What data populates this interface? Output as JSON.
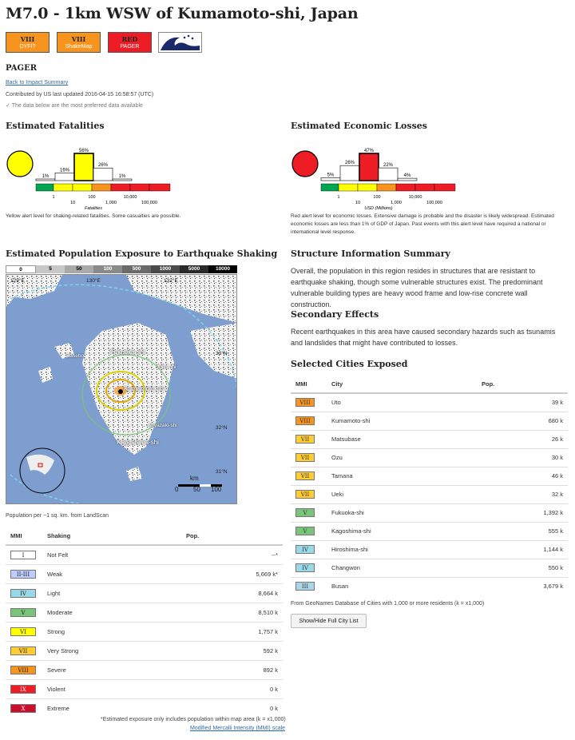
{
  "title": "M7.0 - 1km WSW of Kumamoto-shi, Japan",
  "badges": [
    {
      "level": "VIII",
      "sub": "DYFI?",
      "color": "#f7941d"
    },
    {
      "level": "VIII",
      "sub": "ShakeMap",
      "color": "#f7941d"
    },
    {
      "level": "RED",
      "sub": "PAGER",
      "color": "#ee1c25"
    }
  ],
  "tsunami_icon": "tsunami-icon",
  "section_label": "PAGER",
  "back_link": "Back to Impact Summary",
  "contributed": "Contributed by US last updated 2016-04-15 16:58:57 (UTC)",
  "preferred_note": "The data below are the most preferred data available",
  "fatalities": {
    "heading": "Estimated Fatalities",
    "alert_color": "#ffff00",
    "bars": [
      {
        "pct": "1%",
        "v": 1
      },
      {
        "pct": "16%",
        "v": 16
      },
      {
        "pct": "56%",
        "v": 56
      },
      {
        "pct": "26%",
        "v": 26
      },
      {
        "pct": "1%",
        "v": 1
      }
    ],
    "ticks": [
      "1",
      "10",
      "100",
      "1,000",
      "10,000",
      "100,000"
    ],
    "axis_label": "Fatalities",
    "caption": "Yellow alert level for shaking-related fatalities. Some casualties are possible."
  },
  "losses": {
    "heading": "Estimated Economic Losses",
    "alert_color": "#ee1c25",
    "bars": [
      {
        "pct": "5%",
        "v": 5
      },
      {
        "pct": "26%",
        "v": 26
      },
      {
        "pct": "47%",
        "v": 47
      },
      {
        "pct": "22%",
        "v": 22
      },
      {
        "pct": "4%",
        "v": 4
      }
    ],
    "ticks": [
      "1",
      "10",
      "100",
      "1,000",
      "10,000",
      "100,000"
    ],
    "axis_label": "USD (Millions)",
    "caption": "Red alert level for economic losses. Extensive damage is probable and the disaster is likely widespread. Estimated economic losses are less than 1% of GDP of Japan. Past events with this alert level have required a national or international level response."
  },
  "exposure": {
    "heading": "Estimated Population Exposure to Earthquake Shaking",
    "legend": [
      "0",
      "5",
      "50",
      "100",
      "500",
      "1000",
      "5000",
      "10000"
    ],
    "map_labels": {
      "lon1": "129°E",
      "lon2": "130°E",
      "lon3": "132°E",
      "lat1": "33°N",
      "lat2": "32°N",
      "lat3": "31°N",
      "city1": "Fukuoka-shi",
      "city2": "Kumamoto-shi",
      "city3": "Kagoshima-shi",
      "city4": "Miyazaki-shi",
      "city5": "Oita-shi",
      "city6": "Sasebo",
      "scale_title": "km",
      "scale0": "0",
      "scale50": "50",
      "scale100": "100"
    },
    "pop_note": "Population per ~1 sq. km. from LandScan",
    "table_headers": [
      "MMI",
      "Shaking",
      "Pop."
    ],
    "rows": [
      {
        "mmi": "I",
        "label": "Not Felt",
        "pop": "--*",
        "color": "#ffffff",
        "tc": "#222"
      },
      {
        "mmi": "II-III",
        "label": "Weak",
        "pop": "5,669 k*",
        "color": "#bfccff",
        "tc": "#222"
      },
      {
        "mmi": "IV",
        "label": "Light",
        "pop": "8,664 k",
        "color": "#99d8e6",
        "tc": "#222"
      },
      {
        "mmi": "V",
        "label": "Moderate",
        "pop": "8,510 k",
        "color": "#7ac47a",
        "tc": "#222"
      },
      {
        "mmi": "VI",
        "label": "Strong",
        "pop": "1,757 k",
        "color": "#ffff00",
        "tc": "#222"
      },
      {
        "mmi": "VII",
        "label": "Very Strong",
        "pop": "592 k",
        "color": "#ffcc33",
        "tc": "#222"
      },
      {
        "mmi": "VIII",
        "label": "Severe",
        "pop": "892 k",
        "color": "#f7941d",
        "tc": "#222"
      },
      {
        "mmi": "IX",
        "label": "Violent",
        "pop": "0 k",
        "color": "#ee1c25",
        "tc": "#222"
      },
      {
        "mmi": "X",
        "label": "Extreme",
        "pop": "0 k",
        "color": "#c8102e",
        "tc": "#222"
      }
    ],
    "footnote": "*Estimated exposure only includes population within map area (k = x1,000)",
    "mmi_link": "Modified Mercalli Intensity (MMI) scale"
  },
  "structure": {
    "heading": "Structure Information Summary",
    "text": "Overall, the population in this region resides in structures that are resistant to earthquake shaking, though some vulnerable structures exist. The predominant vulnerable building types are heavy wood frame and low-rise concrete wall construction."
  },
  "secondary": {
    "heading": "Secondary Effects",
    "text": "Recent earthquakes in this area have caused secondary hazards such as tsunamis and landslides that might have contributed to losses."
  },
  "cities": {
    "heading": "Selected Cities Exposed",
    "headers": [
      "MMI",
      "City",
      "Pop."
    ],
    "rows": [
      {
        "mmi": "VIII",
        "city": "Uto",
        "pop": "39 k",
        "color": "#f7941d"
      },
      {
        "mmi": "VIII",
        "city": "Kumamoto-shi",
        "pop": "680 k",
        "color": "#f7941d"
      },
      {
        "mmi": "VII",
        "city": "Matsubase",
        "pop": "26 k",
        "color": "#ffcc33"
      },
      {
        "mmi": "VII",
        "city": "Ozu",
        "pop": "30 k",
        "color": "#ffcc33"
      },
      {
        "mmi": "VII",
        "city": "Tamana",
        "pop": "46 k",
        "color": "#ffcc33"
      },
      {
        "mmi": "VII",
        "city": "Ueki",
        "pop": "32 k",
        "color": "#ffcc33"
      },
      {
        "mmi": "V",
        "city": "Fukuoka-shi",
        "pop": "1,392 k",
        "color": "#7ac47a"
      },
      {
        "mmi": "V",
        "city": "Kagoshima-shi",
        "pop": "555 k",
        "color": "#7ac47a"
      },
      {
        "mmi": "IV",
        "city": "Hiroshima-shi",
        "pop": "1,144 k",
        "color": "#99d8e6"
      },
      {
        "mmi": "IV",
        "city": "Changwon",
        "pop": "550 k",
        "color": "#99d8e6"
      },
      {
        "mmi": "III",
        "city": "Busan",
        "pop": "3,679 k",
        "color": "#a9d6e8"
      }
    ],
    "footnote": "From GeoNames Database of Cities with 1,000 or more residents (k = x1,000)",
    "button": "Show/Hide Full City List"
  }
}
